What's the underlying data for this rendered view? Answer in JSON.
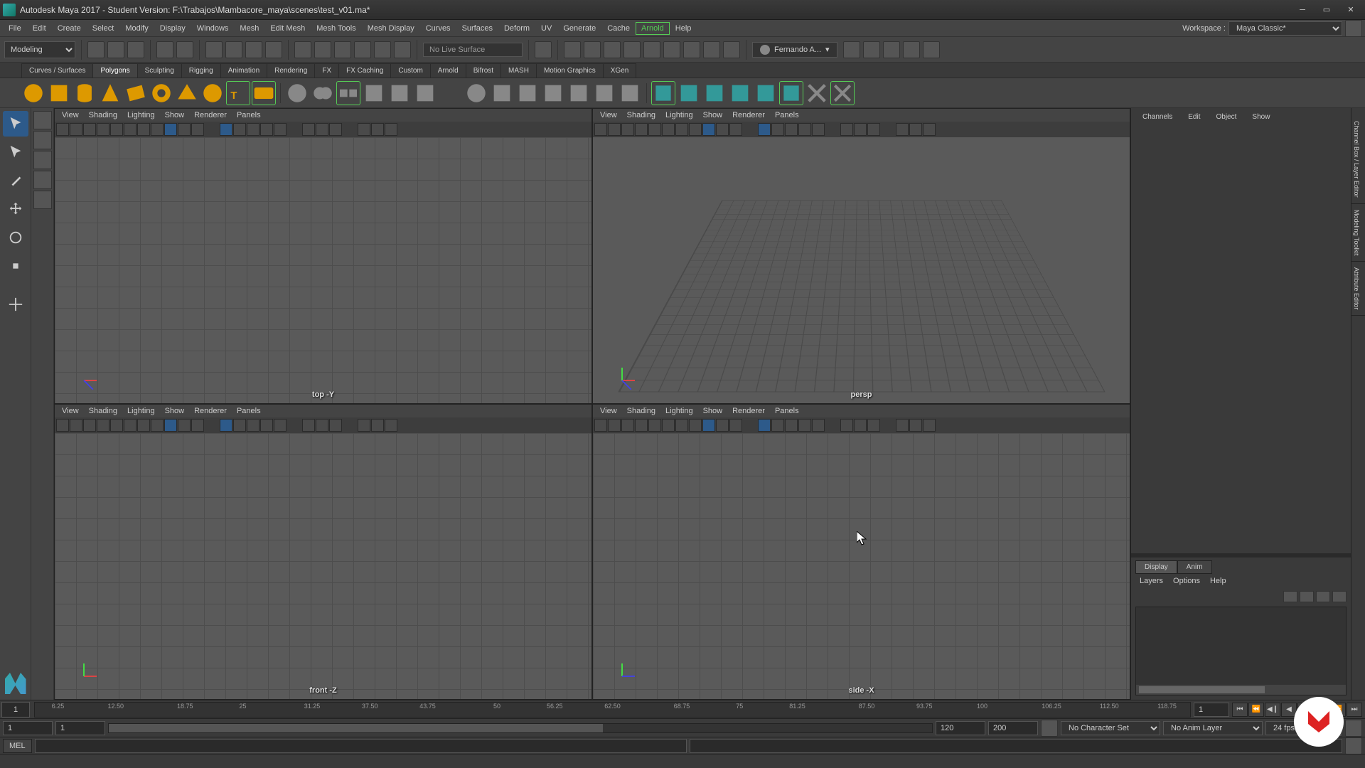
{
  "title": "Autodesk Maya 2017 - Student Version: F:\\Trabajos\\Mambacore_maya\\scenes\\test_v01.ma*",
  "menus": [
    "File",
    "Edit",
    "Create",
    "Select",
    "Modify",
    "Display",
    "Windows",
    "Mesh",
    "Edit Mesh",
    "Mesh Tools",
    "Mesh Display",
    "Curves",
    "Surfaces",
    "Deform",
    "UV",
    "Generate",
    "Cache",
    "Arnold",
    "Help"
  ],
  "workspace": {
    "label": "Workspace :",
    "value": "Maya Classic*"
  },
  "modeSelect": "Modeling",
  "liveObject": "No Live Surface",
  "user": "Fernando A...",
  "shelfTabs": [
    "Curves / Surfaces",
    "Polygons",
    "Sculpting",
    "Rigging",
    "Animation",
    "Rendering",
    "FX",
    "FX Caching",
    "Custom",
    "Arnold",
    "Bifrost",
    "MASH",
    "Motion Graphics",
    "XGen"
  ],
  "activeShelf": "Polygons",
  "viewportMenus": [
    "View",
    "Shading",
    "Lighting",
    "Show",
    "Renderer",
    "Panels"
  ],
  "viewportLabels": {
    "top": "top -Y",
    "persp": "persp",
    "front": "front -Z",
    "side": "side -X"
  },
  "channelTabs": [
    "Channels",
    "Edit",
    "Object",
    "Show"
  ],
  "layerTabs": [
    "Display",
    "Anim"
  ],
  "layerMenu": [
    "Layers",
    "Options",
    "Help"
  ],
  "timeTicks": [
    "1",
    "6.25",
    "12.50",
    "18.75",
    "25",
    "31.25",
    "37.50",
    "43.75",
    "50",
    "56.25",
    "62.50",
    "68.75",
    "75",
    "81.25",
    "87.50",
    "93.75",
    "100",
    "106.25",
    "112.50",
    "118.75"
  ],
  "currentFrame": "1",
  "range": {
    "start": "1",
    "innerStart": "1",
    "innerEnd": "120",
    "end": "200"
  },
  "charSet": "No Character Set",
  "animLayer": "No Anim Layer",
  "fps": "24 fps",
  "cmd": "MEL",
  "sideTabs": [
    "Channel Box / Layer Editor",
    "Modeling Toolkit",
    "Attribute Editor"
  ]
}
